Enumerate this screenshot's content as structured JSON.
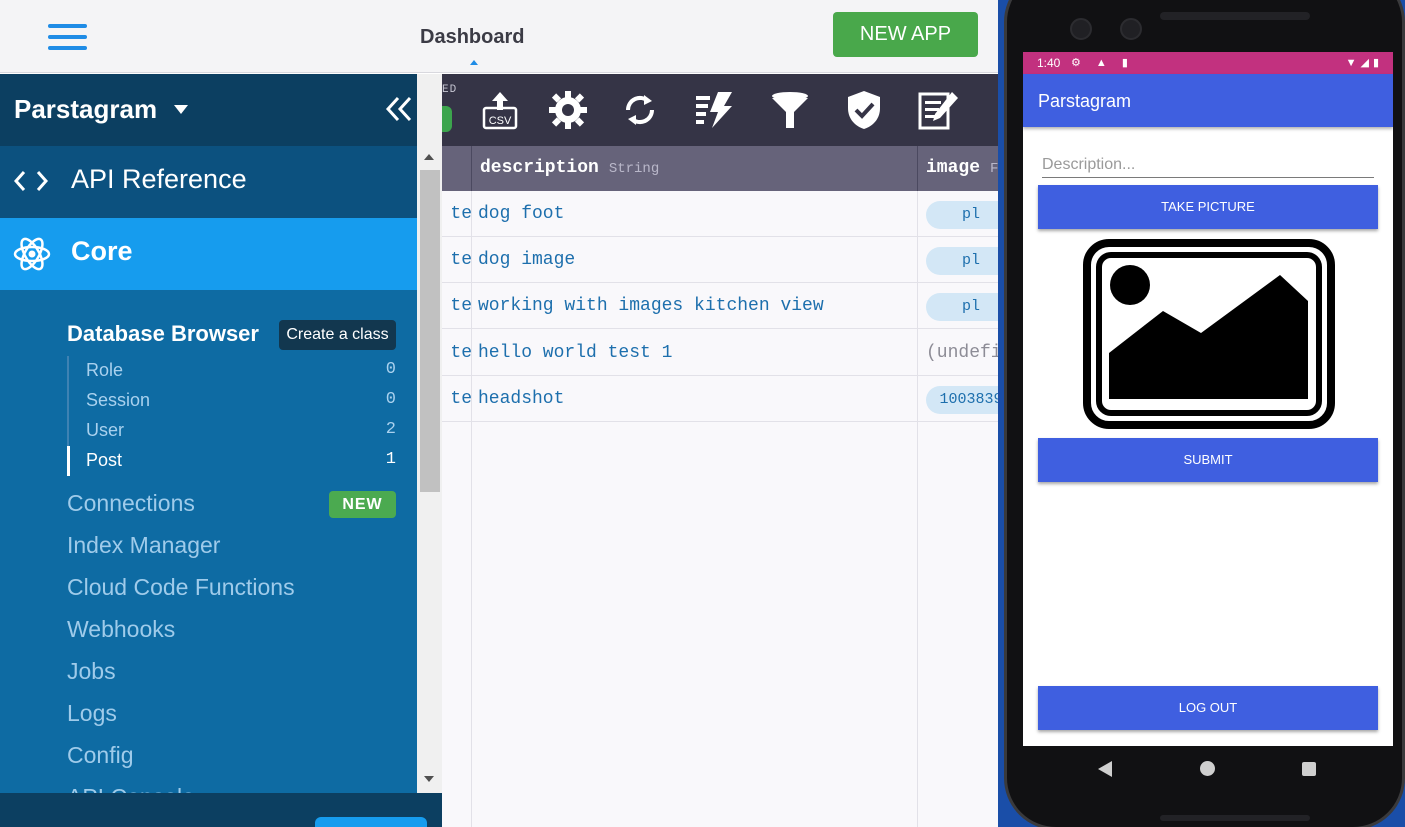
{
  "header": {
    "title": "Dashboard",
    "new_app_label": "NEW APP"
  },
  "toolbar": {
    "partial_label": "ED",
    "icons": [
      "export-csv-icon",
      "gear-icon",
      "refresh-icon",
      "bolt-list-icon",
      "filter-icon",
      "shield-check-icon",
      "edit-icon"
    ]
  },
  "table": {
    "columns": [
      {
        "name": "description",
        "type": "String"
      },
      {
        "name": "image",
        "type": "F"
      }
    ],
    "rows": [
      {
        "c0": "te",
        "description": "dog foot",
        "image": "pl",
        "image_kind": "pill"
      },
      {
        "c0": "te",
        "description": "dog image",
        "image": "pl",
        "image_kind": "pill"
      },
      {
        "c0": "te",
        "description": "working with images kitchen view",
        "image": "pl",
        "image_kind": "pill"
      },
      {
        "c0": "te",
        "description": "hello world test 1",
        "image": "(undefi",
        "image_kind": "text"
      },
      {
        "c0": "te",
        "description": "headshot",
        "image": "1003839",
        "image_kind": "pill"
      }
    ]
  },
  "sidebar": {
    "app_name": "Parstagram",
    "api_reference": "API Reference",
    "core": "Core",
    "database_browser": "Database Browser",
    "create_class_tooltip": "Create a class",
    "classes": [
      {
        "name": "Role",
        "count": "0"
      },
      {
        "name": "Session",
        "count": "0"
      },
      {
        "name": "User",
        "count": "2"
      },
      {
        "name": "Post",
        "count": "1"
      }
    ],
    "nav": [
      "Connections",
      "Index Manager",
      "Cloud Code Functions",
      "Webhooks",
      "Jobs",
      "Logs",
      "Config",
      "API Console"
    ],
    "new_badge": "NEW"
  },
  "phone": {
    "time": "1:40",
    "app_title": "Parstagram",
    "description_placeholder": "Description...",
    "take_picture": "TAKE PICTURE",
    "submit": "SUBMIT",
    "logout": "LOG OUT"
  },
  "colors": {
    "accent": "#169cee",
    "sidebar_bg": "#0e6ba3",
    "new_app_green": "#49a84b",
    "phone_primary": "#3f5fe0",
    "status_bar": "#c2317f"
  }
}
